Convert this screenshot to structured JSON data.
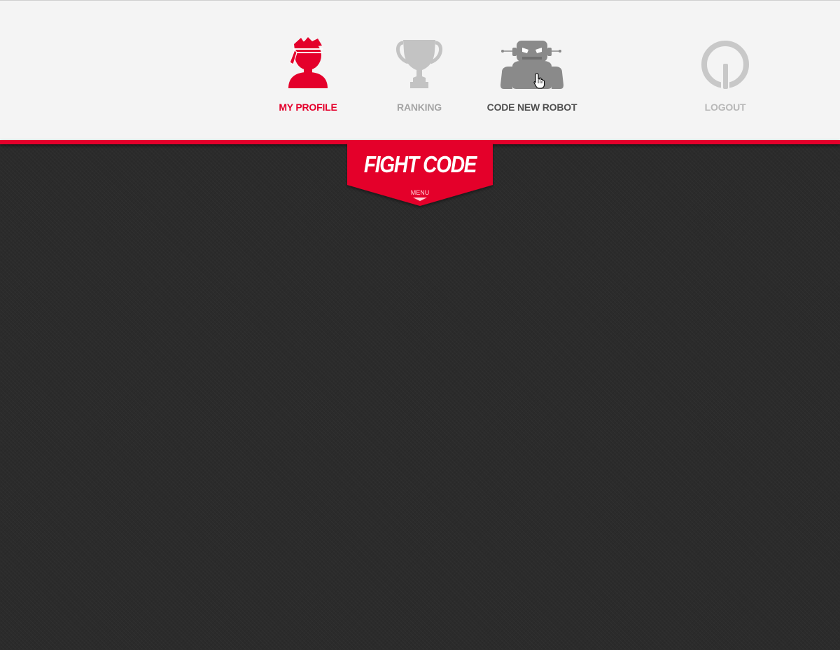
{
  "nav": {
    "items": [
      {
        "id": "profile",
        "label": "MY PROFILE",
        "icon": "ninja-avatar-icon",
        "color": "#e4002b",
        "active": true
      },
      {
        "id": "ranking",
        "label": "RANKING",
        "icon": "trophy-icon",
        "color": "#a5a5a5"
      },
      {
        "id": "robot",
        "label": "CODE NEW ROBOT",
        "icon": "robot-icon",
        "color": "#505050",
        "hovered": true
      },
      {
        "id": "logout",
        "label": "LOGOUT",
        "icon": "power-icon",
        "color": "#b8b8b8"
      }
    ]
  },
  "logo": {
    "title": "FIGHT CODE",
    "menu_label": "MENU",
    "color": "#e4002b"
  },
  "colors": {
    "accent": "#e4002b",
    "background": "#2b2b2b",
    "menu_background": "#f4f4f4"
  }
}
